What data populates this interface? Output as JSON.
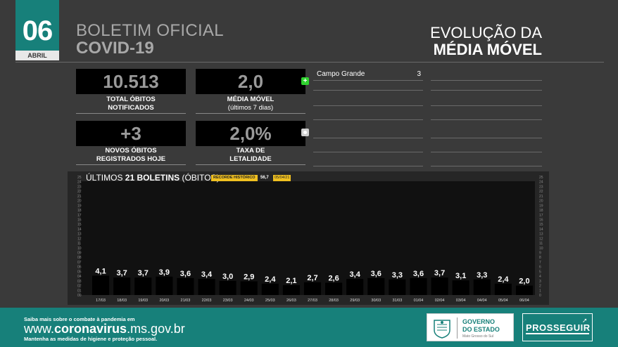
{
  "header": {
    "day": "06",
    "month": "ABRIL",
    "title_line1": "BOLETIM OFICIAL",
    "title_line2": "COVID-19",
    "right_title_line1": "EVOLUÇÃO DA",
    "right_title_line2": "MÉDIA MÓVEL"
  },
  "stats": {
    "total_obitos": {
      "value": "10.513",
      "label_line1": "TOTAL ÓBITOS",
      "label_line2": "NOTIFICADOS"
    },
    "media_movel": {
      "value": "2,0",
      "label_line1": "MÉDIA MÓVEL",
      "label_line2": "(últimos 7 dias)"
    },
    "novos_obitos": {
      "value": "+3",
      "label_line1": "NOVOS ÓBITOS",
      "label_line2": "REGISTRADOS HOJE"
    },
    "taxa_letalidade": {
      "value": "2,0%",
      "label_line1": "TAXA DE",
      "label_line2": "LETALIDADE"
    }
  },
  "indicators": {
    "plus_icon": "plus-icon",
    "plus_glyph": "+",
    "plus_color": "#2fd22f",
    "dot_icon": "dot-icon",
    "dot_color": "#cfcfcf"
  },
  "cities": [
    {
      "name": "Campo Grande",
      "value": "3"
    }
  ],
  "chart_title_prefix": "ÚLTIMOS ",
  "chart_title_bold": "21 BOLETINS",
  "chart_title_suffix": " (ÓBITOS)",
  "record": {
    "label": "RECORDE HISTÓRICO",
    "value": "56,7",
    "date": "05/04/21"
  },
  "chart_data": {
    "type": "bar",
    "categories": [
      "17/03",
      "18/03",
      "19/03",
      "20/03",
      "21/03",
      "22/03",
      "23/03",
      "24/03",
      "25/03",
      "26/03",
      "27/03",
      "28/03",
      "29/03",
      "30/03",
      "31/03",
      "01/04",
      "02/04",
      "03/04",
      "04/04",
      "05/04",
      "06/04"
    ],
    "values": [
      4.1,
      3.7,
      3.7,
      3.9,
      3.6,
      3.4,
      3.0,
      2.9,
      2.4,
      2.1,
      2.7,
      2.6,
      3.4,
      3.6,
      3.3,
      3.6,
      3.7,
      3.1,
      3.3,
      2.4,
      2.0
    ],
    "value_labels": [
      "4,1",
      "3,7",
      "3,7",
      "3,9",
      "3,6",
      "3,4",
      "3,0",
      "2,9",
      "2,4",
      "2,1",
      "2,7",
      "2,6",
      "3,4",
      "3,6",
      "3,3",
      "3,6",
      "3,7",
      "3,1",
      "3,3",
      "2,4",
      "2,0"
    ],
    "ylim": [
      0,
      25
    ],
    "yticks_left": [
      "00",
      "01",
      "02",
      "03",
      "04",
      "05",
      "06",
      "07",
      "08",
      "09",
      "10",
      "11",
      "12",
      "13",
      "14",
      "15",
      "16",
      "17",
      "18",
      "19",
      "20",
      "21",
      "22",
      "23",
      "24",
      "25"
    ],
    "yticks_right": [
      "0",
      "1",
      "2",
      "3",
      "4",
      "5",
      "6",
      "7",
      "8",
      "9",
      "10",
      "11",
      "12",
      "13",
      "14",
      "15",
      "16",
      "17",
      "18",
      "19",
      "20",
      "21",
      "22",
      "23",
      "24",
      "25"
    ],
    "bar_color": "#000000",
    "grid": false
  },
  "footer": {
    "line1": "Saiba mais sobre o combate à pandemia em",
    "url_pre": "www.",
    "url_bold": "coronavirus",
    "url_post": ".ms.gov.br",
    "line3": "Mantenha as medidas de higiene e proteção pessoal.",
    "gov_line1": "GOVERNO",
    "gov_line2": "DO ESTADO",
    "gov_line3": "Mato Grosso do Sul",
    "prosseguir": "PROSSEGUIR"
  },
  "colors": {
    "accent": "#17807a",
    "background": "#3a3a3a",
    "record_badge": "#f0c020"
  }
}
